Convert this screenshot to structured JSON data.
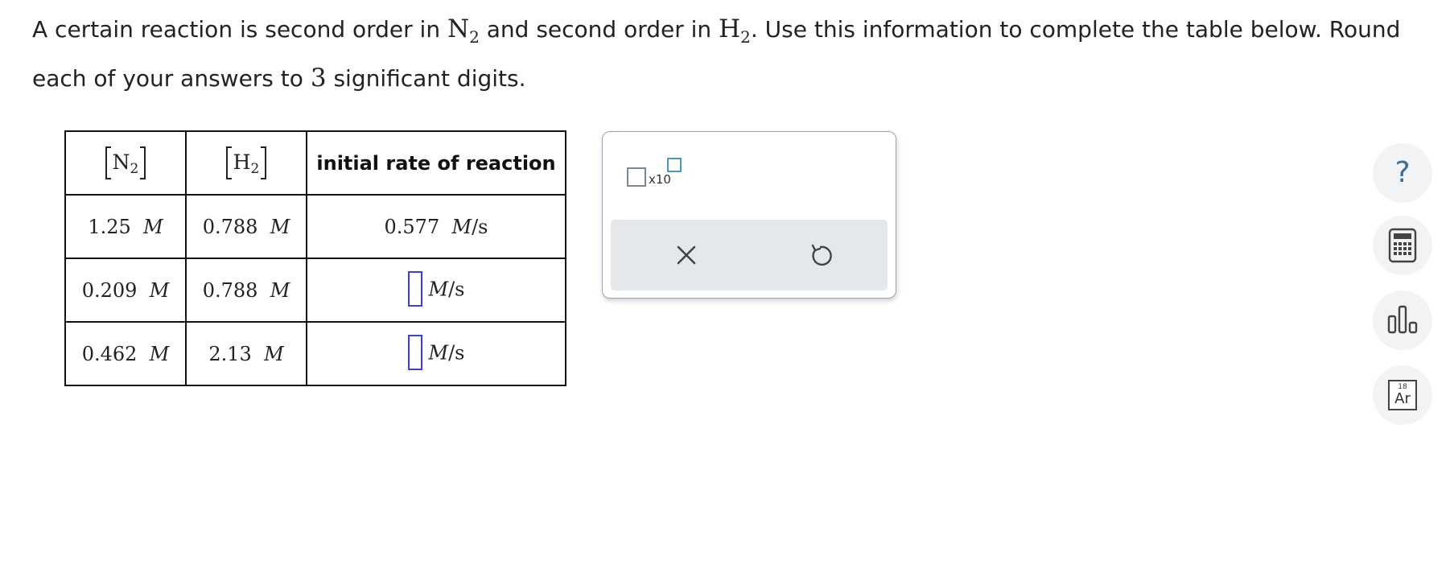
{
  "prompt": {
    "part1": "A certain reaction is second order in ",
    "species_a": "N",
    "species_a_sub": "2",
    "part2": " and second order in ",
    "species_b": "H",
    "species_b_sub": "2",
    "part3": ". Use this information to complete the table below. Round each of your answers to ",
    "sig_figs": "3",
    "part4": " significant digits."
  },
  "table": {
    "headers": {
      "col1_symbol": "N",
      "col1_sub": "2",
      "col2_symbol": "H",
      "col2_sub": "2",
      "col3": "initial rate of reaction"
    },
    "rows": [
      {
        "n2": "1.25",
        "n2_unit": "M",
        "h2": "0.788",
        "h2_unit": "M",
        "rate": "0.577",
        "rate_unit_m": "M",
        "rate_unit_s": "/s"
      },
      {
        "n2": "0.209",
        "n2_unit": "M",
        "h2": "0.788",
        "h2_unit": "M",
        "rate": "",
        "rate_unit_m": "M",
        "rate_unit_s": "/s"
      },
      {
        "n2": "0.462",
        "n2_unit": "M",
        "h2": "2.13",
        "h2_unit": "M",
        "rate": "",
        "rate_unit_m": "M",
        "rate_unit_s": "/s"
      }
    ]
  },
  "palette": {
    "sci_notation_label": "x10",
    "clear_icon": "close-icon",
    "undo_icon": "undo-icon"
  },
  "side_tools": {
    "help_icon": "question-mark-icon",
    "help_glyph": "?",
    "calculator_icon": "calculator-icon",
    "chart_icon": "bar-chart-icon",
    "periodic_table_icon": "periodic-table-icon",
    "periodic_number": "18",
    "periodic_symbol": "Ar"
  },
  "colors": {
    "answer_box_border": "#3b3fe0",
    "exponent_box_border": "#4a9bb3",
    "help_glyph": "#3a6f9a",
    "palette_bar": "#e4e8eb",
    "side_button_bg": "#f1f3f4"
  }
}
